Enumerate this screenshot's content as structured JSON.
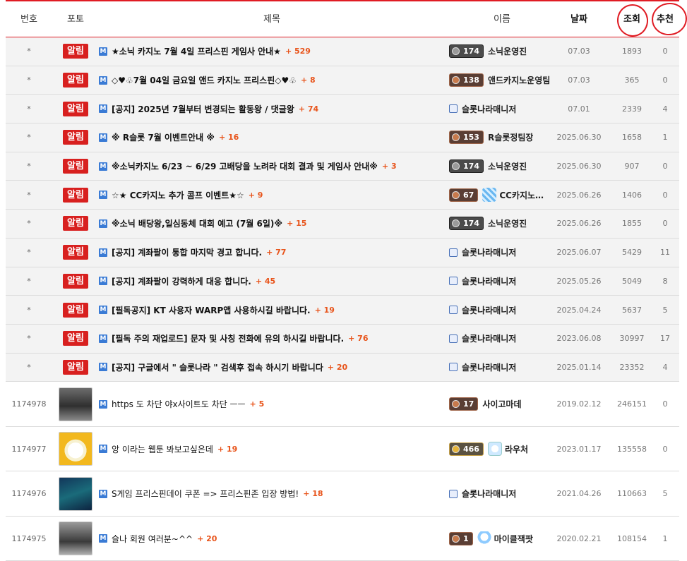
{
  "header": {
    "num": "번호",
    "photo": "포토",
    "title": "제목",
    "name": "이름",
    "date": "날짜",
    "views": "조회",
    "recommend": "추천"
  },
  "notice_badge": "알림",
  "m_icon": "M",
  "notices": [
    {
      "num": "*",
      "title": "★소닉 카지노 7월 4일 프리스핀 게임사 안내★",
      "comments": "+ 529",
      "author_type": "level",
      "level": "174",
      "level_style": "gray",
      "name": "소닉운영진",
      "date": "07.03",
      "views": "1893",
      "rec": "0"
    },
    {
      "num": "*",
      "title": "◇♥♧7월 04일 금요일 앤드 카지노 프리스핀◇♥♧",
      "comments": "+ 8",
      "author_type": "level",
      "level": "138",
      "level_style": "bronze",
      "name": "앤드카지노운영팀",
      "date": "07.03",
      "views": "365",
      "rec": "0"
    },
    {
      "num": "*",
      "title": "[공지] 2025년 7월부터 변경되는 활동왕 / 댓글왕",
      "comments": "+ 74",
      "author_type": "manager",
      "name": "슬롯나라매니저",
      "date": "07.01",
      "views": "2339",
      "rec": "4"
    },
    {
      "num": "*",
      "title": "※ R슬롯 7월 이벤트안내 ※",
      "comments": "+ 16",
      "author_type": "level",
      "level": "153",
      "level_style": "bronze",
      "name": "R슬롯정팀장",
      "date": "2025.06.30",
      "views": "1658",
      "rec": "1"
    },
    {
      "num": "*",
      "title": "※소닉카지노 6/23 ~ 6/29 고배당을 노려라 대회 결과 및 게임사 안내※",
      "comments": "+ 3",
      "author_type": "level",
      "level": "174",
      "level_style": "gray",
      "name": "소닉운영진",
      "date": "2025.06.30",
      "views": "907",
      "rec": "0"
    },
    {
      "num": "*",
      "title": "☆★ CC카지노 추가 콤프 이벤트★☆",
      "comments": "+ 9",
      "author_type": "level_avatar",
      "level": "67",
      "level_style": "bronze",
      "avatar": "a1",
      "name": "CC카지노…",
      "date": "2025.06.26",
      "views": "1406",
      "rec": "0"
    },
    {
      "num": "*",
      "title": "※소닉 배당왕,일심동체 대회 예고 (7월 6일)※",
      "comments": "+ 15",
      "author_type": "level",
      "level": "174",
      "level_style": "gray",
      "name": "소닉운영진",
      "date": "2025.06.26",
      "views": "1855",
      "rec": "0"
    },
    {
      "num": "*",
      "title": "[공지] 계좌팔이 통합 마지막 경고 합니다.",
      "comments": "+ 77",
      "author_type": "manager",
      "name": "슬롯나라매니저",
      "date": "2025.06.07",
      "views": "5429",
      "rec": "11"
    },
    {
      "num": "*",
      "title": "[공지] 계좌팔이 강력하게 대응 합니다.",
      "comments": "+ 45",
      "author_type": "manager",
      "name": "슬롯나라매니저",
      "date": "2025.05.26",
      "views": "5049",
      "rec": "8"
    },
    {
      "num": "*",
      "title": "[필독공지] KT 사용자 WARP앱 사용하시길 바랍니다.",
      "comments": "+ 19",
      "author_type": "manager",
      "name": "슬롯나라매니저",
      "date": "2025.04.24",
      "views": "5637",
      "rec": "5"
    },
    {
      "num": "*",
      "title": "[필독 주의 재업로드] 문자 및 사칭 전화에 유의 하시길 바랍니다.",
      "comments": "+ 76",
      "author_type": "manager",
      "name": "슬롯나라매니저",
      "date": "2023.06.08",
      "views": "30997",
      "rec": "17"
    },
    {
      "num": "*",
      "title": "[공지] 구글에서 \" 슬롯나라 \" 검색후 접속 하시기 바랍니다",
      "comments": "+ 20",
      "author_type": "manager",
      "name": "슬롯나라매니저",
      "date": "2025.01.14",
      "views": "23352",
      "rec": "4"
    }
  ],
  "posts": [
    {
      "num": "1174978",
      "thumb": "t1",
      "title": "https 도 차단 야x사이트도 차단 ㅡㅡ",
      "comments": "+ 5",
      "author_type": "level",
      "level": "17",
      "level_style": "bronze",
      "name": "사이고마데",
      "date": "2019.02.12",
      "views": "246151",
      "rec": "0"
    },
    {
      "num": "1174977",
      "thumb": "t2",
      "title": "앙 이라는 웹툰 봐보고싶은데",
      "comments": "+ 19",
      "author_type": "level_avatar",
      "level": "466",
      "level_style": "gold",
      "avatar": "a2",
      "name": "라우처",
      "date": "2023.01.17",
      "views": "135558",
      "rec": "0"
    },
    {
      "num": "1174976",
      "thumb": "t3",
      "title": "S게임 프리스핀데이 쿠폰 => 프리스핀존 입장 방법!",
      "comments": "+ 18",
      "author_type": "manager",
      "name": "슬롯나라매니저",
      "date": "2021.04.26",
      "views": "110663",
      "rec": "5"
    },
    {
      "num": "1174975",
      "thumb": "t4",
      "title": "슬나 회원 여러분~^^",
      "comments": "+ 20",
      "author_type": "level_avatar",
      "level": "1",
      "level_style": "bronze",
      "avatar": "a3",
      "name": "마이클잭팟",
      "date": "2020.02.21",
      "views": "108154",
      "rec": "1"
    }
  ]
}
